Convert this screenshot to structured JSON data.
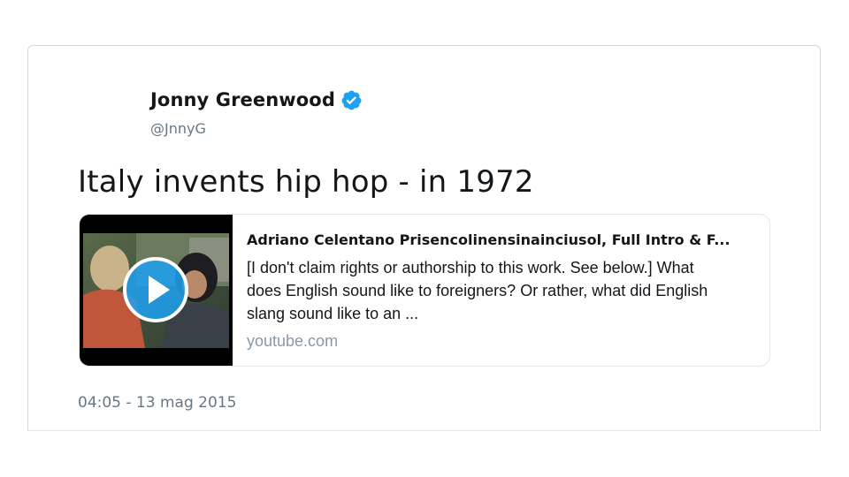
{
  "tweet": {
    "author": {
      "name": "Jonny Greenwood",
      "handle": "@JnnyG",
      "verified": true
    },
    "text": "Italy invents hip hop - in 1972",
    "timestamp": "04:05 - 13 mag 2015"
  },
  "link_card": {
    "title": "Adriano Celentano Prisencolinensinainciusol, Full Intro & F...",
    "description_lines": [
      "[I don't claim rights or authorship to this work. See below.] What",
      "does English sound like to foreigners? Or rather, what did English",
      "slang sound like to an ..."
    ],
    "domain": "youtube.com",
    "thumbnail_icon": "play-icon"
  },
  "colors": {
    "verified_blue": "#1da1f2",
    "text_primary": "#14171a",
    "text_secondary": "#657786",
    "border": "#e1e8ed"
  }
}
